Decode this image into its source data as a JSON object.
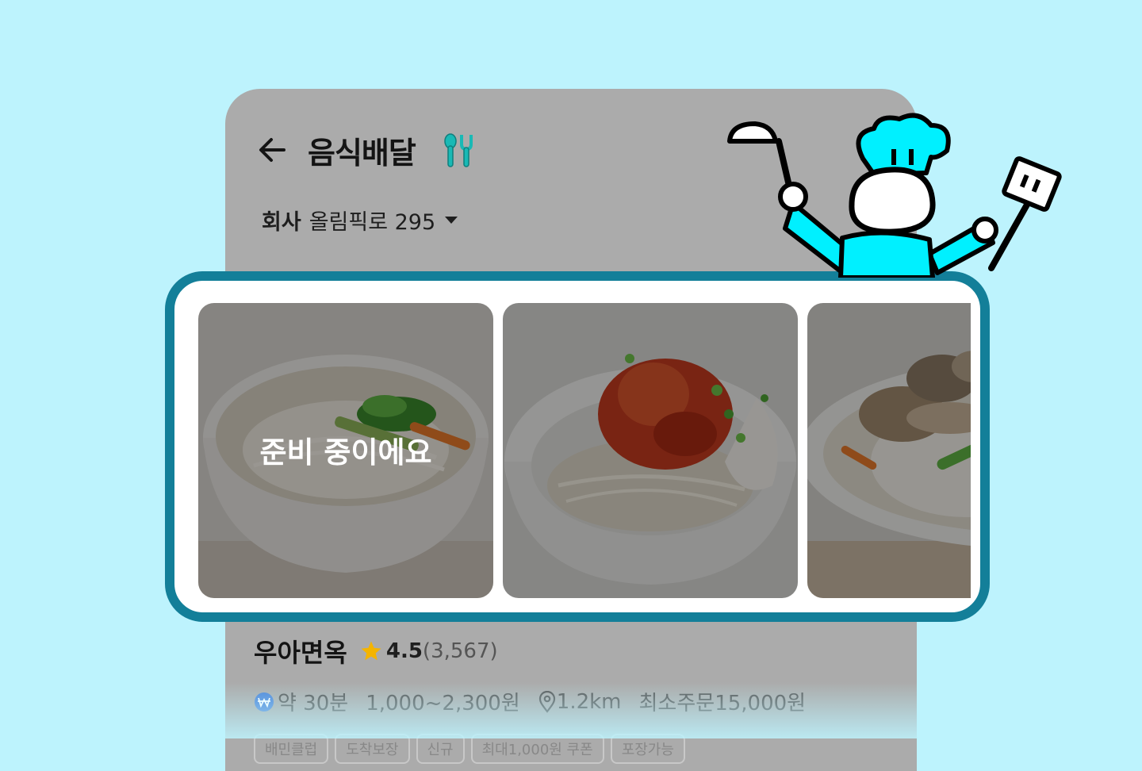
{
  "header": {
    "title": "음식배달"
  },
  "address": {
    "label": "회사",
    "value": "올림픽로 295"
  },
  "carousel": {
    "status_text": "준비 중이에요"
  },
  "store": {
    "name": "우아면옥",
    "rating": "4.5",
    "review_count": "(3,567)",
    "delivery_time": "약 30분",
    "delivery_fee": "1,000~2,300원",
    "distance": "1.2km",
    "min_order_label": "최소주문",
    "min_order_value": "15,000원",
    "tags": [
      "배민클럽",
      "도착보장",
      "신규",
      "최대1,000원 쿠폰",
      "포장가능"
    ]
  },
  "colors": {
    "background": "#bdf3fd",
    "frame": "#137f99",
    "accent_cyan": "#00f0ff",
    "star": "#f4b400"
  }
}
